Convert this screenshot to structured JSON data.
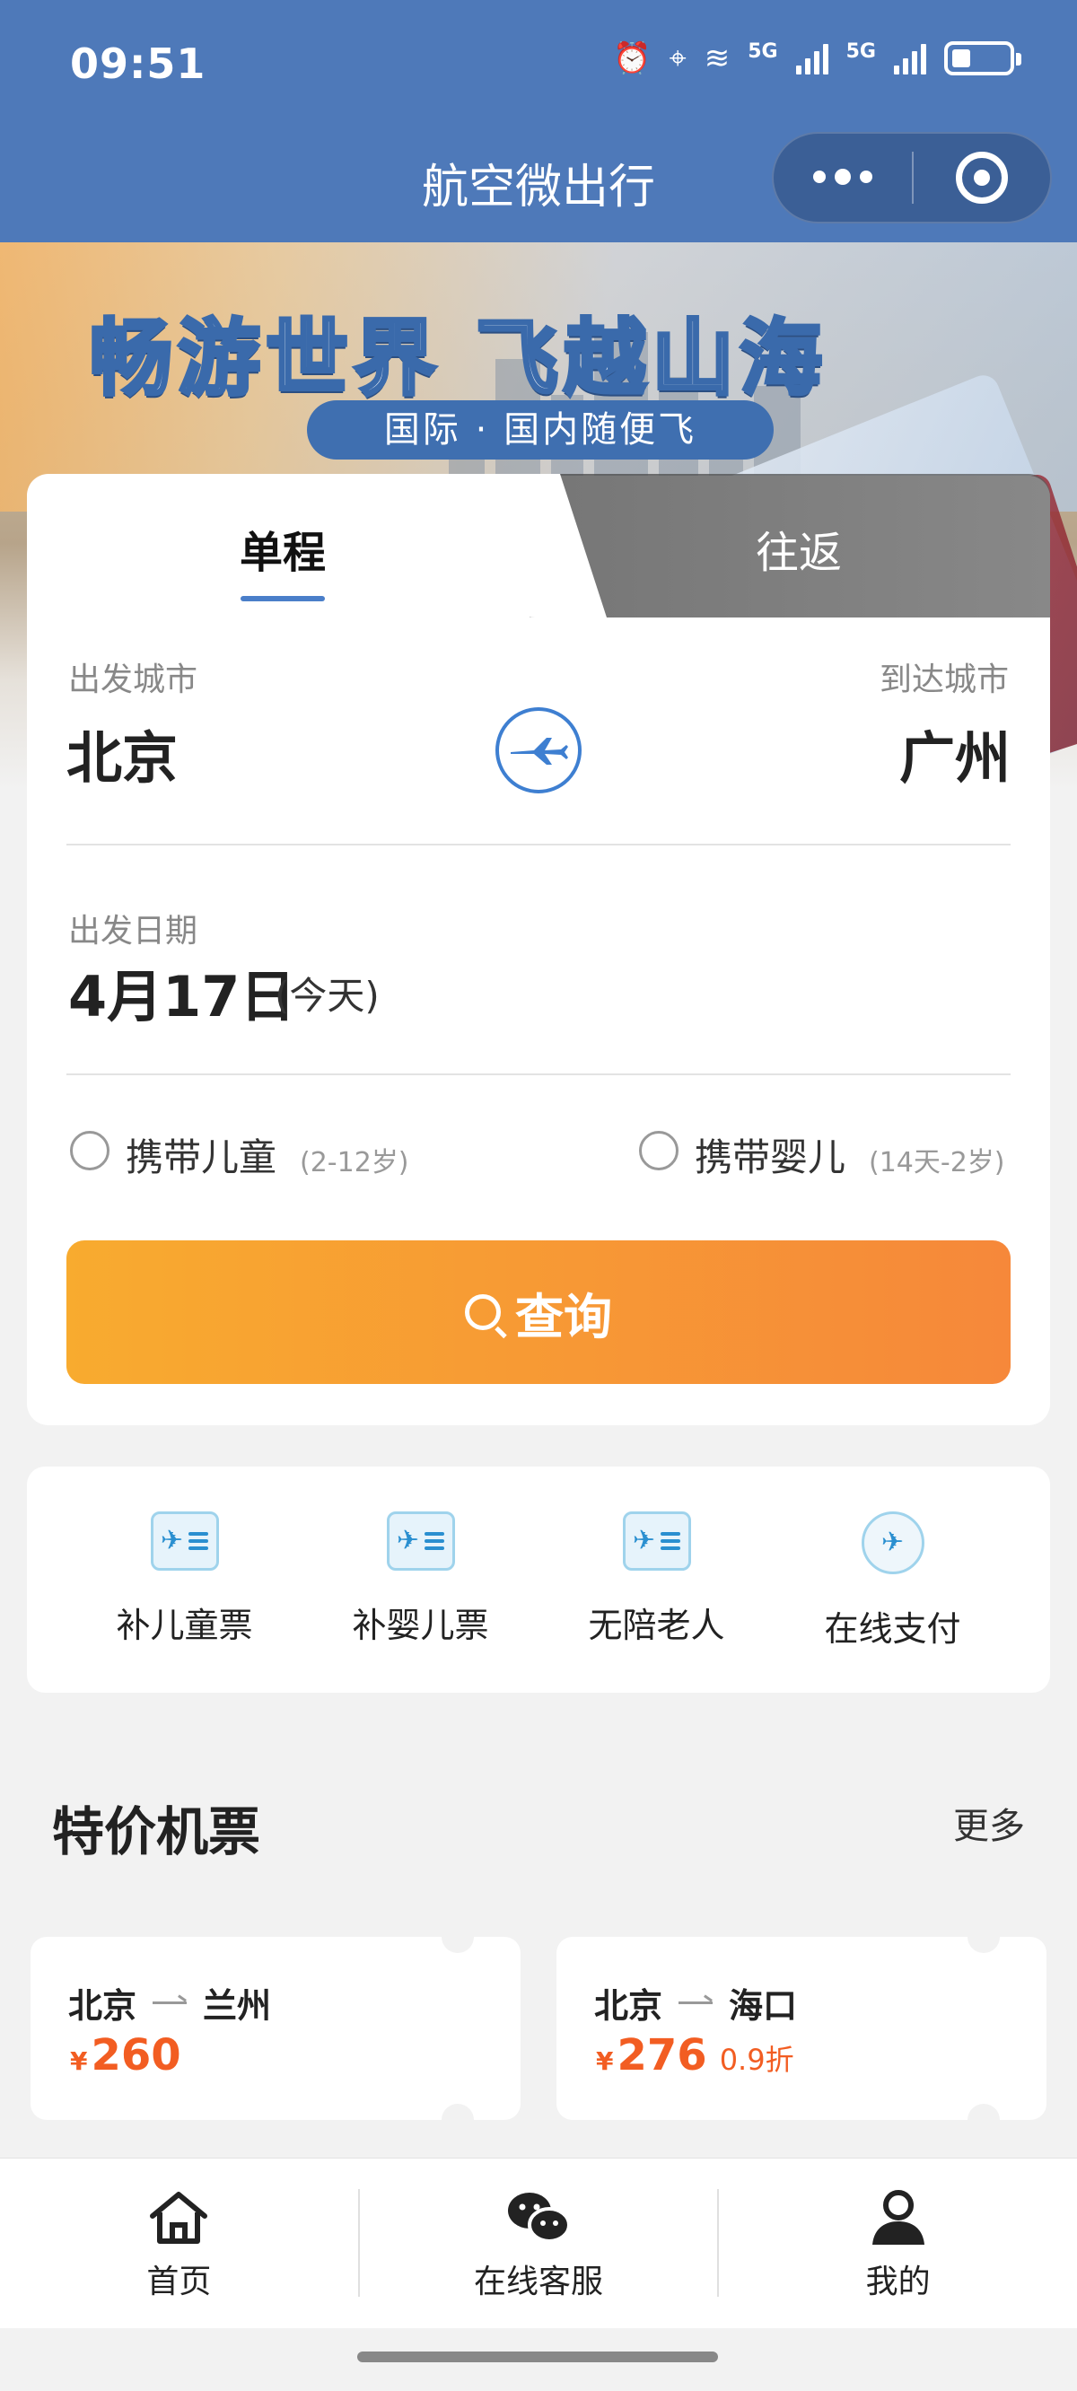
{
  "status": {
    "time": "09:51",
    "net1": "5G",
    "net2": "5G",
    "wifi_num": "6"
  },
  "nav": {
    "title": "航空微出行",
    "more_icon": "more-icon",
    "target_icon": "target-icon"
  },
  "banner": {
    "title": "畅游世界  飞越山海",
    "subtitle": "国际 · 国内随便飞"
  },
  "tabs": [
    {
      "label": "单程",
      "active": true
    },
    {
      "label": "往返",
      "active": false
    }
  ],
  "route": {
    "from_label": "出发城市",
    "from_city": "北京",
    "to_label": "到达城市",
    "to_city": "广州"
  },
  "date": {
    "label": "出发日期",
    "value": "4月17日",
    "suffix": "(今天)"
  },
  "options": [
    {
      "label": "携带儿童",
      "note": "(2-12岁)",
      "checked": false
    },
    {
      "label": "携带婴儿",
      "note": "(14天-2岁)",
      "checked": false
    }
  ],
  "search_button": "查询",
  "services": [
    {
      "label": "补儿童票",
      "icon": "ticket-icon"
    },
    {
      "label": "补婴儿票",
      "icon": "ticket-icon"
    },
    {
      "label": "无陪老人",
      "icon": "ticket-icon"
    },
    {
      "label": "在线支付",
      "icon": "payment-icon"
    }
  ],
  "deals_section": {
    "title": "特价机票",
    "more": "更多"
  },
  "deals": [
    {
      "from": "北京",
      "to": "兰州",
      "currency": "¥",
      "price": "260",
      "discount": ""
    },
    {
      "from": "北京",
      "to": "海口",
      "currency": "¥",
      "price": "276",
      "discount": "0.9折"
    }
  ],
  "tabbar": [
    {
      "label": "首页",
      "icon": "home-icon"
    },
    {
      "label": "在线客服",
      "icon": "wechat-icon"
    },
    {
      "label": "我的",
      "icon": "user-icon"
    }
  ],
  "colors": {
    "header": "#4e79b9",
    "accent": "#4a7ec9",
    "price": "#f25d22",
    "button_start": "#f8ab2f",
    "button_end": "#f6883a"
  }
}
